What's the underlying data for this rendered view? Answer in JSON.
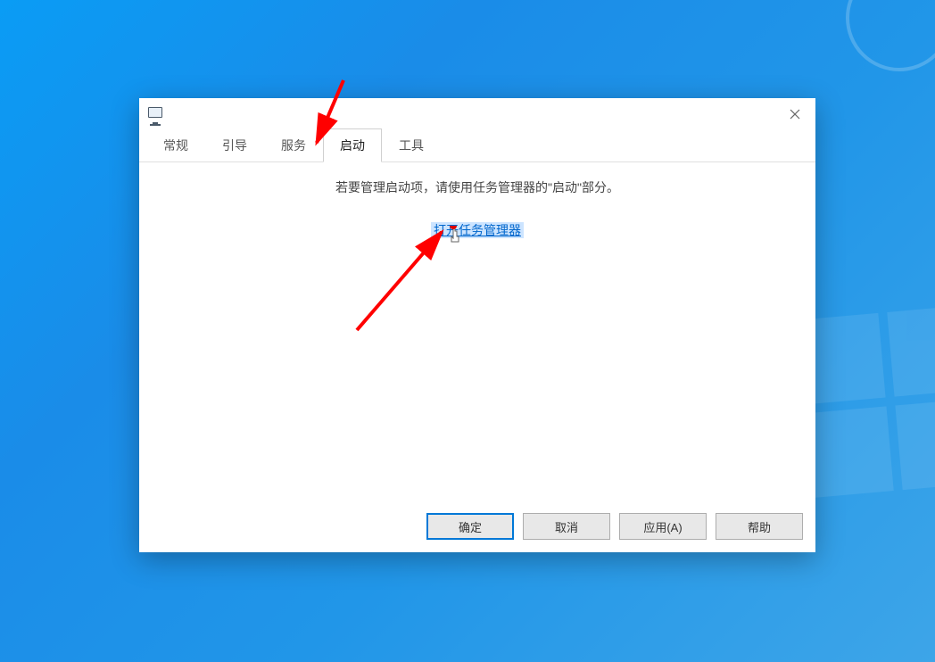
{
  "window": {
    "close_tooltip": "关闭"
  },
  "tabs": [
    {
      "label": "常规",
      "active": false
    },
    {
      "label": "引导",
      "active": false
    },
    {
      "label": "服务",
      "active": false
    },
    {
      "label": "启动",
      "active": true
    },
    {
      "label": "工具",
      "active": false
    }
  ],
  "content": {
    "instruction": "若要管理启动项，请使用任务管理器的\"启动\"部分。",
    "link_text": "打开任务管理器"
  },
  "buttons": {
    "ok": "确定",
    "cancel": "取消",
    "apply": "应用(A)",
    "help": "帮助"
  }
}
